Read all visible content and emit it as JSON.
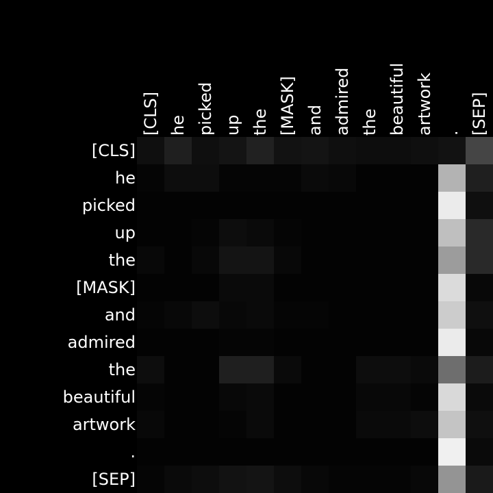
{
  "chart_data": {
    "type": "heatmap",
    "title": "",
    "xlabel": "",
    "ylabel": "",
    "x_tokens": [
      "[CLS]",
      "he",
      "picked",
      "up",
      "the",
      "[MASK]",
      "and",
      "admired",
      "the",
      "beautiful",
      "artwork",
      ".",
      "[SEP]"
    ],
    "y_tokens": [
      "[CLS]",
      "he",
      "picked",
      "up",
      "the",
      "[MASK]",
      "and",
      "admired",
      "the",
      "beautiful",
      "artwork",
      ".",
      "[SEP]"
    ],
    "value_range": [
      0,
      1
    ],
    "colormap": "gray",
    "values": [
      [
        0.06,
        0.12,
        0.06,
        0.08,
        0.13,
        0.07,
        0.08,
        0.06,
        0.05,
        0.05,
        0.06,
        0.07,
        0.27
      ],
      [
        0.02,
        0.05,
        0.05,
        0.02,
        0.02,
        0.02,
        0.04,
        0.03,
        0.01,
        0.01,
        0.01,
        0.7,
        0.12
      ],
      [
        0.01,
        0.01,
        0.01,
        0.01,
        0.01,
        0.01,
        0.01,
        0.01,
        0.01,
        0.01,
        0.01,
        0.92,
        0.06
      ],
      [
        0.01,
        0.01,
        0.02,
        0.05,
        0.04,
        0.02,
        0.01,
        0.01,
        0.01,
        0.01,
        0.01,
        0.75,
        0.16
      ],
      [
        0.03,
        0.01,
        0.03,
        0.08,
        0.08,
        0.03,
        0.01,
        0.01,
        0.01,
        0.01,
        0.01,
        0.61,
        0.16
      ],
      [
        0.01,
        0.01,
        0.01,
        0.04,
        0.04,
        0.01,
        0.01,
        0.01,
        0.01,
        0.01,
        0.01,
        0.86,
        0.03
      ],
      [
        0.02,
        0.03,
        0.05,
        0.03,
        0.04,
        0.02,
        0.02,
        0.01,
        0.01,
        0.01,
        0.01,
        0.8,
        0.06
      ],
      [
        0.01,
        0.01,
        0.01,
        0.02,
        0.02,
        0.01,
        0.01,
        0.01,
        0.01,
        0.01,
        0.01,
        0.92,
        0.03
      ],
      [
        0.05,
        0.01,
        0.01,
        0.12,
        0.12,
        0.04,
        0.01,
        0.01,
        0.05,
        0.05,
        0.04,
        0.43,
        0.11
      ],
      [
        0.02,
        0.01,
        0.01,
        0.03,
        0.04,
        0.01,
        0.01,
        0.01,
        0.03,
        0.03,
        0.02,
        0.85,
        0.04
      ],
      [
        0.03,
        0.01,
        0.01,
        0.02,
        0.04,
        0.01,
        0.01,
        0.01,
        0.04,
        0.04,
        0.05,
        0.77,
        0.06
      ],
      [
        0.01,
        0.01,
        0.01,
        0.01,
        0.01,
        0.01,
        0.01,
        0.01,
        0.01,
        0.01,
        0.01,
        0.94,
        0.04
      ],
      [
        0.02,
        0.04,
        0.05,
        0.07,
        0.08,
        0.05,
        0.03,
        0.02,
        0.02,
        0.02,
        0.03,
        0.58,
        0.1
      ]
    ]
  }
}
